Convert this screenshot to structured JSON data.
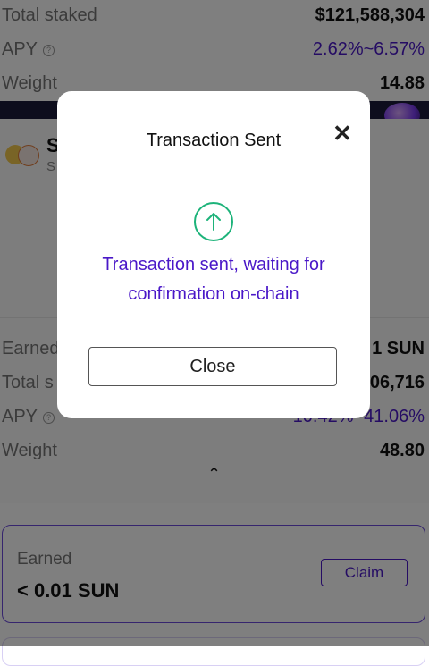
{
  "top_stats": {
    "total_staked_label": "Total staked",
    "total_staked_value": "$121,588,304",
    "apy_label": "APY",
    "apy_value": "2.62%~6.57%",
    "weight_label": "Weight",
    "weight_value": "14.88"
  },
  "pool": {
    "name_visible": "S",
    "subtitle_visible": "S"
  },
  "pool_stats": {
    "earned_label_visible": "Earned",
    "earned_value_visible": "1 SUN",
    "total_staked_label_visible": "Total s",
    "total_staked_value_visible": "06,716",
    "apy_label": "APY",
    "apy_value_visible": "10.42%~41.06%",
    "weight_label": "Weight",
    "weight_value": "48.80"
  },
  "earned_card": {
    "label": "Earned",
    "value": "< 0.01 SUN",
    "claim_label": "Claim"
  },
  "modal": {
    "title": "Transaction Sent",
    "close_icon": "✕",
    "status_icon": "arrow-up-circle-icon",
    "message": "Transaction sent, waiting for confirmation on-chain",
    "close_button_label": "Close"
  },
  "colors": {
    "accent_purple": "#4a18c8",
    "success_green": "#1db37a",
    "overlay": "rgba(0,0,0,0.5)"
  }
}
